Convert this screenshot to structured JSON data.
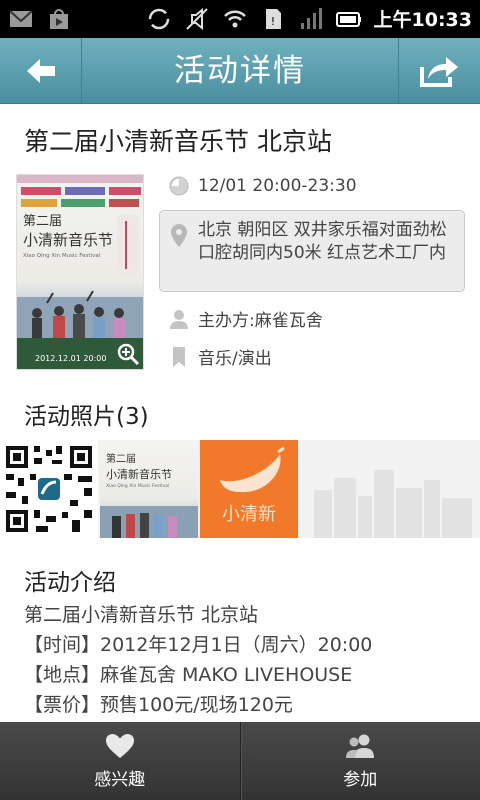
{
  "status_bar": {
    "left_icons": [
      "mail-icon",
      "play-store-icon"
    ],
    "right_icons": [
      "sync-icon",
      "mute-icon",
      "wifi-icon",
      "sim-icon",
      "signal-icon",
      "battery-icon"
    ],
    "time": "上午10:33"
  },
  "header": {
    "title": "活动详情",
    "back_icon": "back-arrow-icon",
    "share_icon": "share-icon",
    "color": "#5a9eae"
  },
  "event": {
    "title": "第二届小清新音乐节 北京站",
    "time": "12/01 20:00-23:30",
    "address": "北京 朝阳区 双井家乐福对面劲松口腔胡同内50米 红点艺术工厂内",
    "organizer": "主办方:麻雀瓦舍",
    "category": "音乐/演出",
    "poster": {
      "title_line": "第二届",
      "brand": "小清新音乐节",
      "english": "Xiao Qing Xin Music Festival",
      "date": "2012.12.01 20:00"
    }
  },
  "photos": {
    "title": "活动照片(3)",
    "orange_label": "小清新"
  },
  "intro": {
    "title": "活动介绍",
    "lines": [
      "第二届小清新音乐节 北京站",
      "【时间】2012年12月1日（周六）20:00",
      "【地点】麻雀瓦舍 MAKO LIVEHOUSE",
      "【票价】预售100元/现场120元"
    ]
  },
  "bottom_bar": {
    "interested_label": "感兴趣",
    "join_label": "参加"
  }
}
